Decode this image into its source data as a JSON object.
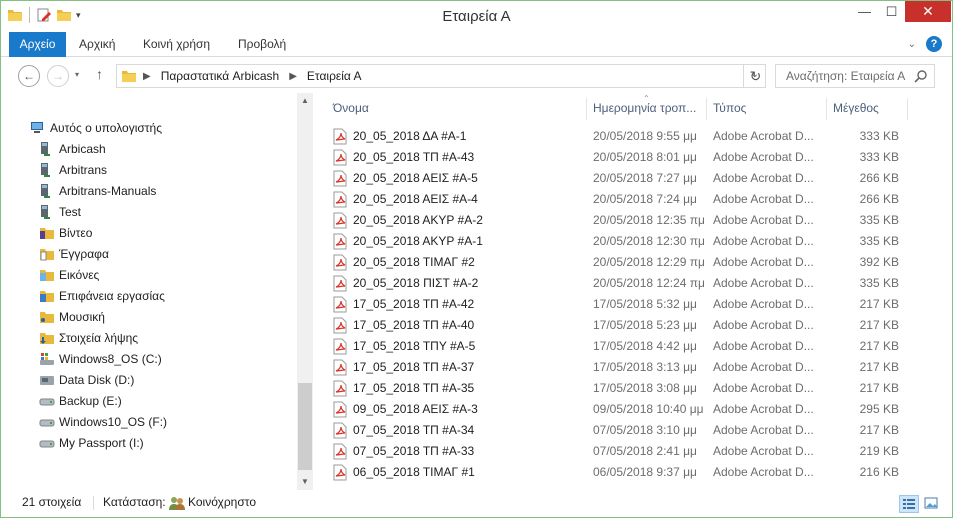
{
  "window": {
    "title": "Εταιρεία Α",
    "close_glyph": "✕",
    "min_glyph": "—",
    "max_glyph": "☐"
  },
  "ribbon": {
    "tabs": [
      "Αρχείο",
      "Αρχική",
      "Κοινή χρήση",
      "Προβολή"
    ],
    "help": "?"
  },
  "address": {
    "crumbs": [
      "Παραστατικά Arbicash",
      "Εταιρεία Α"
    ],
    "search_placeholder": "Αναζήτηση: Εταιρεία Α"
  },
  "colors": {
    "accent": "#1979ca",
    "close": "#c7302b",
    "header_text": "#4c607a",
    "pdf_red": "#d9322b"
  },
  "tree": {
    "items": [
      {
        "label": "Αυτός ο υπολογιστής",
        "icon": "computer-icon"
      },
      {
        "label": "Arbicash",
        "icon": "network-drive-icon"
      },
      {
        "label": "Arbitrans",
        "icon": "network-drive-icon"
      },
      {
        "label": "Arbitrans-Manuals",
        "icon": "network-drive-icon"
      },
      {
        "label": "Test",
        "icon": "network-drive-icon"
      },
      {
        "label": "Βίντεο",
        "icon": "videos-folder-icon"
      },
      {
        "label": "Έγγραφα",
        "icon": "documents-folder-icon"
      },
      {
        "label": "Εικόνες",
        "icon": "pictures-folder-icon"
      },
      {
        "label": "Επιφάνεια εργασίας",
        "icon": "desktop-folder-icon"
      },
      {
        "label": "Μουσική",
        "icon": "music-folder-icon"
      },
      {
        "label": "Στοιχεία λήψης",
        "icon": "downloads-folder-icon"
      },
      {
        "label": "Windows8_OS (C:)",
        "icon": "system-drive-icon"
      },
      {
        "label": "Data Disk (D:)",
        "icon": "disk-drive-icon"
      },
      {
        "label": "Backup (E:)",
        "icon": "removable-drive-icon"
      },
      {
        "label": "Windows10_OS (F:)",
        "icon": "removable-drive-icon"
      },
      {
        "label": "My Passport (I:)",
        "icon": "removable-drive-icon"
      }
    ]
  },
  "columns": {
    "name": "Όνομα",
    "date": "Ημερομηνία τροπ...",
    "type": "Τύπος",
    "size": "Μέγεθος"
  },
  "files": [
    {
      "name": "20_05_2018 ΔΑ #Α-1",
      "date": "20/05/2018 9:55 μμ",
      "type": "Adobe Acrobat D...",
      "size": "333 KB"
    },
    {
      "name": "20_05_2018 ΤΠ #Α-43",
      "date": "20/05/2018 8:01 μμ",
      "type": "Adobe Acrobat D...",
      "size": "333 KB"
    },
    {
      "name": "20_05_2018 ΑΕΙΣ #Α-5",
      "date": "20/05/2018 7:27 μμ",
      "type": "Adobe Acrobat D...",
      "size": "266 KB"
    },
    {
      "name": "20_05_2018 ΑΕΙΣ #Α-4",
      "date": "20/05/2018 7:24 μμ",
      "type": "Adobe Acrobat D...",
      "size": "266 KB"
    },
    {
      "name": "20_05_2018 ΑΚΥΡ #Α-2",
      "date": "20/05/2018 12:35 πμ",
      "type": "Adobe Acrobat D...",
      "size": "335 KB"
    },
    {
      "name": "20_05_2018 ΑΚΥΡ #Α-1",
      "date": "20/05/2018 12:30 πμ",
      "type": "Adobe Acrobat D...",
      "size": "335 KB"
    },
    {
      "name": "20_05_2018 ΤΙΜΑΓ #2",
      "date": "20/05/2018 12:29 πμ",
      "type": "Adobe Acrobat D...",
      "size": "392 KB"
    },
    {
      "name": "20_05_2018 ΠΙΣΤ #Α-2",
      "date": "20/05/2018 12:24 πμ",
      "type": "Adobe Acrobat D...",
      "size": "335 KB"
    },
    {
      "name": "17_05_2018 ΤΠ #Α-42",
      "date": "17/05/2018 5:32 μμ",
      "type": "Adobe Acrobat D...",
      "size": "217 KB"
    },
    {
      "name": "17_05_2018 ΤΠ #Α-40",
      "date": "17/05/2018 5:23 μμ",
      "type": "Adobe Acrobat D...",
      "size": "217 KB"
    },
    {
      "name": "17_05_2018 ΤΠΥ #Α-5",
      "date": "17/05/2018 4:42 μμ",
      "type": "Adobe Acrobat D...",
      "size": "217 KB"
    },
    {
      "name": "17_05_2018 ΤΠ #Α-37",
      "date": "17/05/2018 3:13 μμ",
      "type": "Adobe Acrobat D...",
      "size": "217 KB"
    },
    {
      "name": "17_05_2018 ΤΠ #Α-35",
      "date": "17/05/2018 3:08 μμ",
      "type": "Adobe Acrobat D...",
      "size": "217 KB"
    },
    {
      "name": "09_05_2018 ΑΕΙΣ #Α-3",
      "date": "09/05/2018 10:40 μμ",
      "type": "Adobe Acrobat D...",
      "size": "295 KB"
    },
    {
      "name": "07_05_2018 ΤΠ #Α-34",
      "date": "07/05/2018 3:10 μμ",
      "type": "Adobe Acrobat D...",
      "size": "217 KB"
    },
    {
      "name": "07_05_2018 ΤΠ #Α-33",
      "date": "07/05/2018 2:41 μμ",
      "type": "Adobe Acrobat D...",
      "size": "219 KB"
    },
    {
      "name": "06_05_2018 ΤΙΜΑΓ #1",
      "date": "06/05/2018 9:37 μμ",
      "type": "Adobe Acrobat D...",
      "size": "216 KB"
    }
  ],
  "status": {
    "count": "21 στοιχεία",
    "state_label": "Κατάσταση:",
    "state_value": "Κοινόχρηστο"
  }
}
